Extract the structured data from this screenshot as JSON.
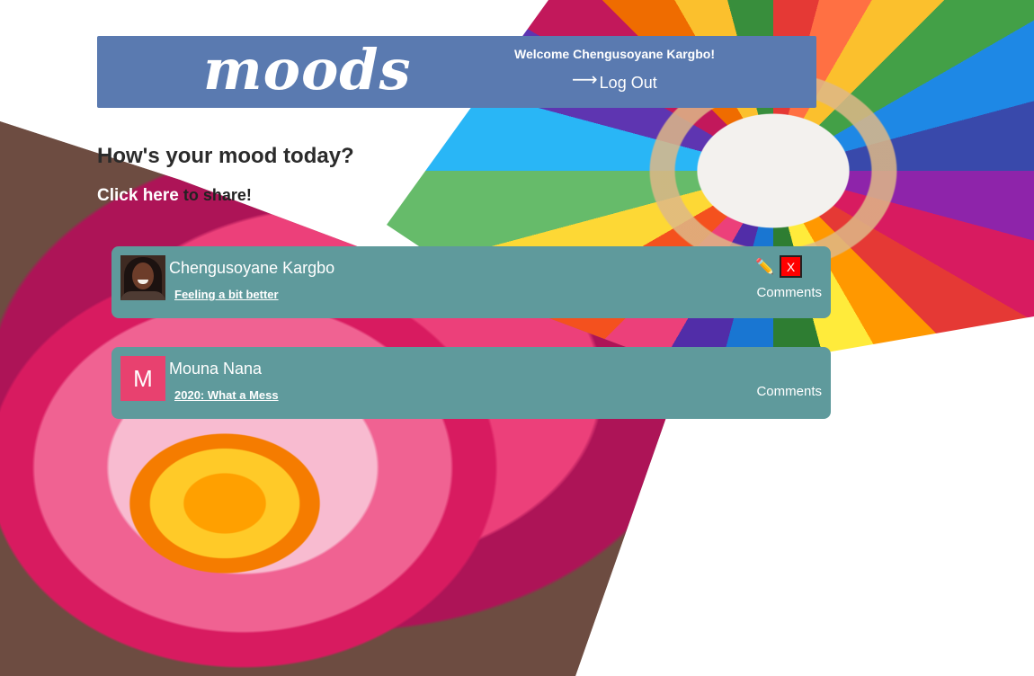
{
  "header": {
    "logo": "moods",
    "welcome": "Welcome Chengusoyane Kargbo!",
    "logout_arrow": "⟶",
    "logout_label": "Log Out"
  },
  "prompt": {
    "title": "How's your mood today?",
    "click_here": "Click here",
    "rest": " to share!"
  },
  "posts": [
    {
      "author": "Chengusoyane Kargbo",
      "title": "Feeling a bit better",
      "comments_label": "Comments",
      "avatar_type": "photo",
      "edit_icon": "✏️",
      "delete_label": "X"
    },
    {
      "author": "Mouna Nana",
      "title": "2020: What a Mess",
      "comments_label": "Comments",
      "avatar_type": "letter",
      "avatar_letter": "M",
      "avatar_color": "#e8416f"
    }
  ],
  "colors": {
    "header_bg": "#5a7ab0",
    "post_bg": "#5f9a9c",
    "delete_bg": "#ff0000"
  }
}
